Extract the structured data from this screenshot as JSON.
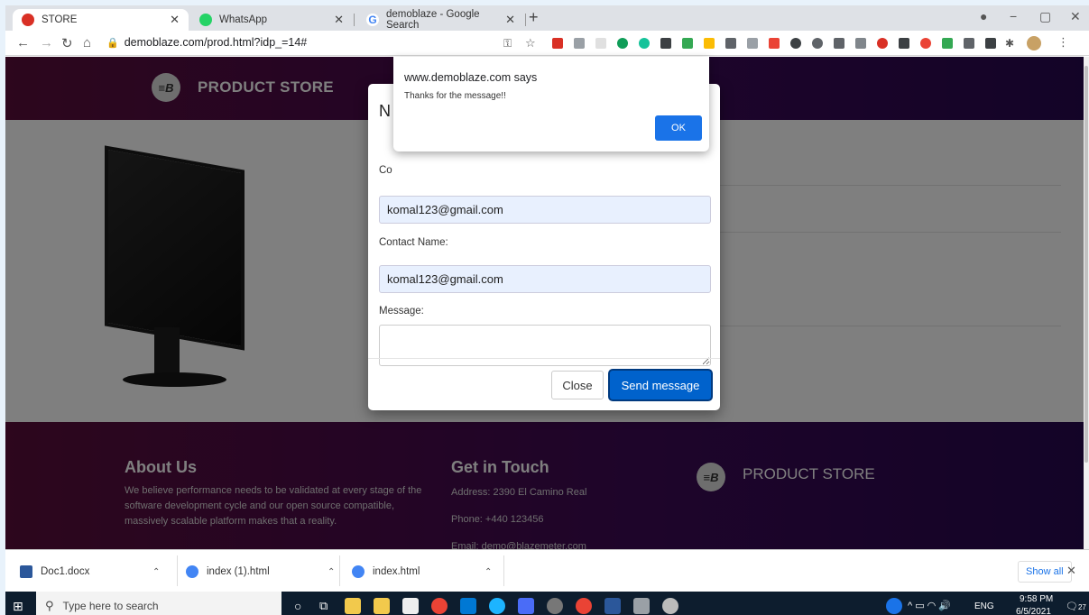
{
  "browser": {
    "tabs": [
      {
        "title": "STORE",
        "favicon_color": "#d93025"
      },
      {
        "title": "WhatsApp",
        "favicon_color": "#25d366"
      },
      {
        "title": "demoblaze - Google Search",
        "favicon_color": "#4285f4"
      }
    ],
    "url": "demoblaze.com/prod.html?idp_=14#"
  },
  "site": {
    "brand": "PRODUCT STORE",
    "logo_mark": "≡B"
  },
  "modal": {
    "title_partial": "N",
    "contact_email_label_partial": "Co",
    "contact_email_value": "komal123@gmail.com",
    "contact_name_label": "Contact Name:",
    "contact_name_value": "komal123@gmail.com",
    "message_label": "Message:",
    "message_value": "",
    "close_label": "Close",
    "send_label": "Send message"
  },
  "alert": {
    "title": "www.demoblaze.com says",
    "message": "Thanks for the message!!",
    "ok_label": "OK"
  },
  "footer": {
    "about_title": "About Us",
    "about_text": "We believe performance needs to be validated at every stage of the software development cycle and our open source compatible, massively scalable platform makes that a reality.",
    "contact_title": "Get in Touch",
    "address": "Address: 2390 El Camino Real",
    "phone": "Phone: +440 123456",
    "email": "Email: demo@blazemeter.com",
    "brand": "PRODUCT STORE"
  },
  "downloads": {
    "items": [
      {
        "name": "Doc1.docx",
        "icon_color": "#2b579a"
      },
      {
        "name": "index (1).html",
        "icon_color": "#4285f4"
      },
      {
        "name": "index.html",
        "icon_color": "#4285f4"
      }
    ],
    "show_all": "Show all"
  },
  "taskbar": {
    "search_placeholder": "Type here to search",
    "language": "ENG",
    "time": "9:58 PM",
    "date": "6/5/2021",
    "notifications": "27"
  }
}
